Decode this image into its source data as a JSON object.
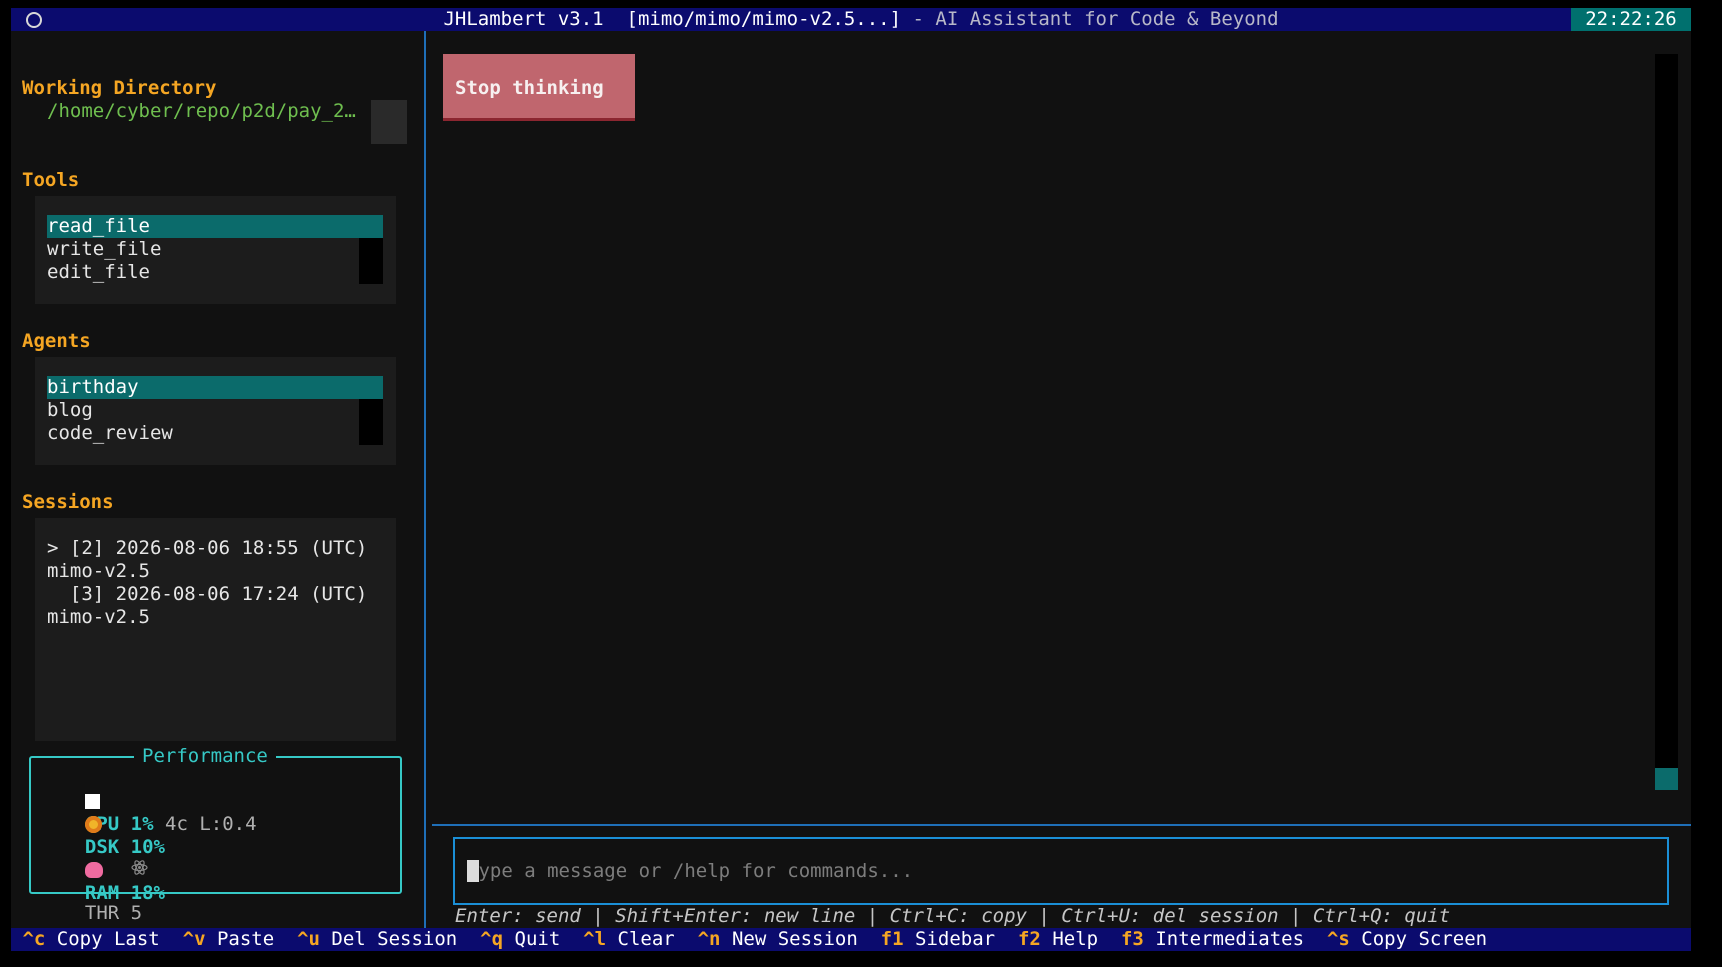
{
  "window": {
    "app_name": "JHLambert v3.1",
    "model": "[mimo/mimo/mimo-v2.5...]",
    "description": "- AI Assistant for Code & Beyond",
    "clock": "22:22:26"
  },
  "sidebar": {
    "working_directory": {
      "heading": "Working Directory",
      "path": "/home/cyber/repo/p2d/pay_2…"
    },
    "tools": {
      "heading": "Tools",
      "items": [
        "read_file",
        "write_file",
        "edit_file"
      ],
      "selected": 0
    },
    "agents": {
      "heading": "Agents",
      "items": [
        "birthday",
        "blog",
        "code_review"
      ],
      "selected": 0
    },
    "sessions": {
      "heading": "Sessions",
      "items": [
        {
          "line1": "> [2] 2026-08-06 18:55 (UTC)",
          "line2": "mimo-v2.5"
        },
        {
          "line1": "  [3] 2026-08-06 17:24 (UTC)",
          "line2": "mimo-v2.5"
        }
      ]
    },
    "performance": {
      "title": "Performance",
      "cpu": {
        "label": "CPU",
        "value": "1%",
        "detail": "4c L:0.4"
      },
      "dsk": {
        "label": "DSK",
        "value": "10%"
      },
      "thr": {
        "label": "THR",
        "value": "5"
      },
      "ram": {
        "label": "RAM",
        "value": "18%"
      }
    }
  },
  "main": {
    "stop_button": "Stop thinking",
    "input": {
      "placeholder": "Type a message or /help for commands...",
      "value": ""
    },
    "hint": "Enter: send | Shift+Enter: new line | Ctrl+C: copy | Ctrl+U: del session | Ctrl+Q: quit"
  },
  "footer": {
    "shortcuts": [
      {
        "key": "^c",
        "label": "Copy Last"
      },
      {
        "key": "^v",
        "label": "Paste"
      },
      {
        "key": "^u",
        "label": "Del Session"
      },
      {
        "key": "^q",
        "label": "Quit"
      },
      {
        "key": "^l",
        "label": "Clear"
      },
      {
        "key": "^n",
        "label": "New Session"
      },
      {
        "key": "f1",
        "label": "Sidebar"
      },
      {
        "key": "f2",
        "label": "Help"
      },
      {
        "key": "f3",
        "label": "Intermediates"
      },
      {
        "key": "^s",
        "label": "Copy Screen"
      }
    ]
  },
  "colors": {
    "accent_heading": "#f5a623",
    "selection": "#0b6b6b",
    "path": "#6fbf4f",
    "perf": "#36c9c6",
    "titlebar": "#0b0b6e",
    "stop_button": "#c0666e"
  }
}
